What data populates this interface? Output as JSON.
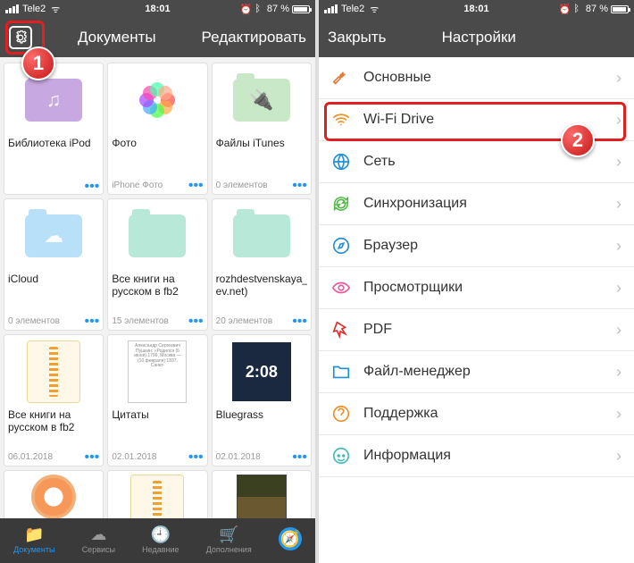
{
  "status": {
    "carrier": "Tele2",
    "wifi_glyph": "ᯤ",
    "time": "18:01",
    "alarm_glyph": "⏰",
    "bt_glyph": "ᛒ",
    "battery_pct": "87 %"
  },
  "left": {
    "header": {
      "title": "Документы",
      "edit": "Редактировать"
    },
    "tiles": [
      {
        "name": "Библиотека iPod",
        "meta": "",
        "kind": "folder-purple",
        "glyph": "♫"
      },
      {
        "name": "Фото",
        "meta": "iPhone Фото",
        "kind": "photos"
      },
      {
        "name": "Файлы iTunes",
        "meta": "0 элементов",
        "kind": "folder-green",
        "glyph": "🔌"
      },
      {
        "name": "iCloud",
        "meta": "0 элементов",
        "kind": "folder-sky",
        "glyph": "☁"
      },
      {
        "name": "Все книги на русском в fb2",
        "meta": "15 элементов",
        "kind": "folder-mint"
      },
      {
        "name": "rozhdestvenskaya_m…ev.net)",
        "meta": "20 элементов",
        "kind": "folder-mint"
      },
      {
        "name": "Все книги на русском в fb2",
        "meta": "06.01.2018",
        "kind": "zip"
      },
      {
        "name": "Цитаты",
        "meta": "02.01.2018",
        "kind": "doc",
        "doctext": "Александр Сергеевич Пушкин: «Родился (6 июня) 1799, Москва — (10 февраля) 1837, Санкт-"
      },
      {
        "name": "Bluegrass",
        "meta": "02.01.2018",
        "kind": "album",
        "albumtext": "2:08"
      },
      {
        "name": "",
        "meta": "",
        "kind": "donut"
      },
      {
        "name": "",
        "meta": "",
        "kind": "zip"
      },
      {
        "name": "",
        "meta": "",
        "kind": "mona"
      }
    ],
    "tabs": [
      {
        "label": "Документы",
        "glyph": "📁",
        "active": true
      },
      {
        "label": "Сервисы",
        "glyph": "☁",
        "active": false
      },
      {
        "label": "Недавние",
        "glyph": "🕘",
        "active": false
      },
      {
        "label": "Дополнения",
        "glyph": "🛒",
        "active": false
      },
      {
        "label": "",
        "glyph": "🧭",
        "active": false,
        "solid": true
      }
    ]
  },
  "right": {
    "header": {
      "close": "Закрыть",
      "title": "Настройки"
    },
    "rows": [
      {
        "label": "Основные",
        "color": "#e87838",
        "icon": "wrench"
      },
      {
        "label": "Wi-Fi Drive",
        "color": "#f09028",
        "icon": "wifi",
        "highlight": true
      },
      {
        "label": "Сеть",
        "color": "#2090d8",
        "icon": "globe"
      },
      {
        "label": "Синхронизация",
        "color": "#50b848",
        "icon": "sync"
      },
      {
        "label": "Браузер",
        "color": "#2090d8",
        "icon": "compass"
      },
      {
        "label": "Просмотрщики",
        "color": "#e85898",
        "icon": "eye"
      },
      {
        "label": "PDF",
        "color": "#d83030",
        "icon": "pdf"
      },
      {
        "label": "Файл-менеджер",
        "color": "#2090d8",
        "icon": "folder"
      },
      {
        "label": "Поддержка",
        "color": "#f09028",
        "icon": "help"
      },
      {
        "label": "Информация",
        "color": "#48b8b8",
        "icon": "info"
      }
    ]
  },
  "callouts": {
    "one": "1",
    "two": "2"
  }
}
